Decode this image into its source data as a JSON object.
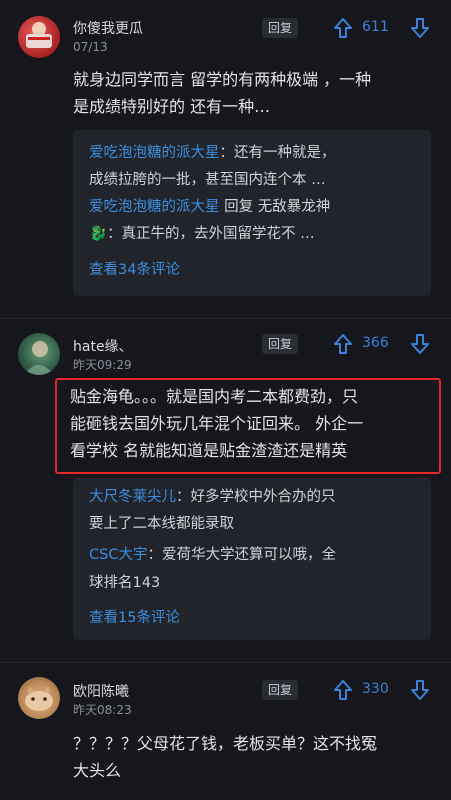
{
  "comments": [
    {
      "username": "你傻我更瓜",
      "time": "07/13",
      "reply_label": "回复",
      "votes": "611",
      "body": [
        "就身边同学而言 留学的有两种极端 ，一种",
        "是成绩特别好的 还有一种…"
      ],
      "replies": [
        {
          "name": "爱吃泡泡糖的派大星",
          "sep": "：",
          "text": "还有一种就是，"
        },
        {
          "text": "成绩拉胯的一批，甚至国内连个本 …"
        },
        {
          "name": "爱吃泡泡糖的派大星",
          "sub": " 回复 无敌暴龙神"
        },
        {
          "emoji": "🐉",
          "text": "：真正牛的，去外国留学花不 …"
        }
      ],
      "more": "查看34条评论"
    },
    {
      "username": "hate缘、",
      "time": "昨天09:29",
      "reply_label": "回复",
      "votes": "366",
      "body": [
        "贴金海龟。。。就是国内考二本都费劲，只",
        "能砸钱去国外玩几年混个证回来。 外企一",
        "看学校 名就能知道是贴金渣渣还是精英"
      ],
      "replies": [
        {
          "name": "大尺冬莱尖儿",
          "sep": "：",
          "text": "好多学校中外合办的只"
        },
        {
          "text": "要上了二本线都能录取"
        },
        {
          "name": "CSC大宇",
          "sep": "：",
          "text": "爱荷华大学还算可以哦，全"
        },
        {
          "text": "球排名143"
        }
      ],
      "more": "查看15条评论"
    },
    {
      "username": "欧阳陈曦",
      "time": "昨天08:23",
      "reply_label": "回复",
      "votes": "330",
      "body": [
        "？？？？父母花了钱，老板买单？这不找冤",
        "大头么"
      ]
    }
  ],
  "icons": {
    "upvote": "upvote-arrow-icon",
    "downvote": "downvote-arrow-icon"
  },
  "colors": {
    "background": "#16171d",
    "accent": "#3b82d6",
    "highlight": "#e8262c",
    "reply_box": "#22242c"
  }
}
